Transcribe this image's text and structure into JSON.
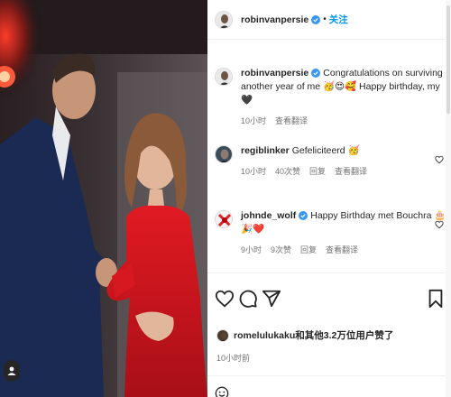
{
  "post": {
    "author": "robinvanpersie",
    "follow_label": "关注",
    "separator": "•"
  },
  "caption": {
    "author": "robinvanpersie",
    "text": "Congratulations on surviving another year of me 🥳😍🥰 Happy birthday, my 🖤",
    "time": "10小时",
    "translate": "查看翻译"
  },
  "comments": [
    {
      "author": "regiblinker",
      "text": "Gefeliciteerd 🥳",
      "time": "10小时",
      "likes": "40次赞",
      "reply": "回复",
      "translate": "查看翻译"
    },
    {
      "author": "johnde_wolf",
      "text": "Happy Birthday met Bouchra 🎂🎉❤️",
      "time": "9小时",
      "likes": "9次赞",
      "reply": "回复",
      "translate": "查看翻译"
    }
  ],
  "likes_summary": {
    "text": "romelulukaku和其他3.2万位用户赞了"
  },
  "post_time": "10小时前",
  "icons": {
    "verified": "verified-badge-icon",
    "like": "heart-icon",
    "comment": "comment-icon",
    "share": "share-icon",
    "save": "bookmark-icon",
    "user": "user-tag-icon"
  },
  "colors": {
    "link": "#0095f6",
    "verified": "#3897f0",
    "text": "#262626",
    "muted": "#737373"
  }
}
